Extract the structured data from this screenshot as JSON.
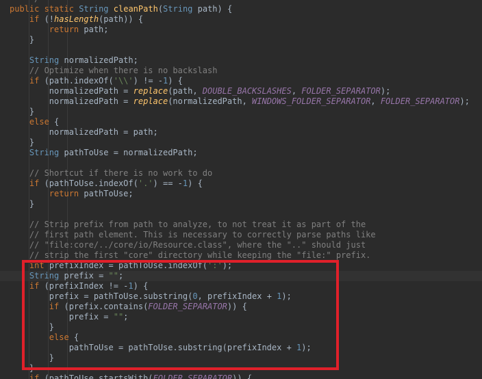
{
  "editor": {
    "lines": [
      {
        "t": "    */",
        "cls": "cm"
      },
      {
        "t": "public static String cleanPath(String path) {",
        "cls": ""
      },
      {
        "t": "    if (!hasLength(path)) {",
        "cls": ""
      },
      {
        "t": "        return path;",
        "cls": ""
      },
      {
        "t": "    }",
        "cls": ""
      },
      {
        "t": "",
        "cls": ""
      },
      {
        "t": "    String normalizedPath;",
        "cls": ""
      },
      {
        "t": "    // Optimize when there is no backslash",
        "cls": "cm"
      },
      {
        "t": "    if (path.indexOf('\\\\') != -1) {",
        "cls": ""
      },
      {
        "t": "        normalizedPath = replace(path, DOUBLE_BACKSLASHES, FOLDER_SEPARATOR);",
        "cls": ""
      },
      {
        "t": "        normalizedPath = replace(normalizedPath, WINDOWS_FOLDER_SEPARATOR, FOLDER_SEPARATOR);",
        "cls": ""
      },
      {
        "t": "    }",
        "cls": ""
      },
      {
        "t": "    else {",
        "cls": ""
      },
      {
        "t": "        normalizedPath = path;",
        "cls": ""
      },
      {
        "t": "    }",
        "cls": ""
      },
      {
        "t": "    String pathToUse = normalizedPath;",
        "cls": ""
      },
      {
        "t": "",
        "cls": ""
      },
      {
        "t": "    // Shortcut if there is no work to do",
        "cls": "cm"
      },
      {
        "t": "    if (pathToUse.indexOf('.') == -1) {",
        "cls": ""
      },
      {
        "t": "        return pathToUse;",
        "cls": ""
      },
      {
        "t": "    }",
        "cls": ""
      },
      {
        "t": "",
        "cls": ""
      },
      {
        "t": "    // Strip prefix from path to analyze, to not treat it as part of the",
        "cls": "cm"
      },
      {
        "t": "    // first path element. This is necessary to correctly parse paths like",
        "cls": "cm"
      },
      {
        "t": "    // \"file:core/../core/io/Resource.class\", where the \"..\" should just",
        "cls": "cm"
      },
      {
        "t": "    // strip the first \"core\" directory while keeping the \"file:\" prefix.",
        "cls": "cm"
      },
      {
        "t": "    int prefixIndex = pathToUse.indexOf(':');",
        "cls": ""
      },
      {
        "t": "    String prefix = \"\";",
        "cls": "current"
      },
      {
        "t": "    if (prefixIndex != -1) {",
        "cls": ""
      },
      {
        "t": "        prefix = pathToUse.substring(0, prefixIndex + 1);",
        "cls": ""
      },
      {
        "t": "        if (prefix.contains(FOLDER_SEPARATOR)) {",
        "cls": ""
      },
      {
        "t": "            prefix = \"\";",
        "cls": ""
      },
      {
        "t": "        }",
        "cls": ""
      },
      {
        "t": "        else {",
        "cls": ""
      },
      {
        "t": "            pathToUse = pathToUse.substring(prefixIndex + 1);",
        "cls": ""
      },
      {
        "t": "        }",
        "cls": ""
      },
      {
        "t": "    }",
        "cls": ""
      },
      {
        "t": "    if (pathToUse.startsWith(FOLDER_SEPARATOR)) {",
        "cls": ""
      }
    ]
  }
}
